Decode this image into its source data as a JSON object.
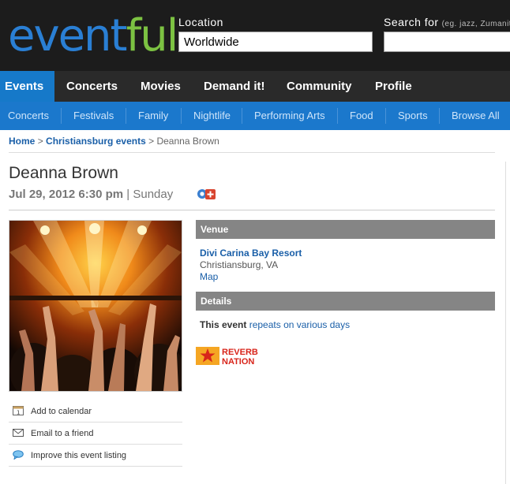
{
  "header": {
    "logo_part1": "event",
    "logo_part2": "ful",
    "location_label": "Location",
    "location_value": "Worldwide",
    "search_label": "Search for",
    "search_hint": "(eg. jazz, Zumanit"
  },
  "nav": {
    "items": [
      "Events",
      "Concerts",
      "Movies",
      "Demand it!",
      "Community",
      "Profile"
    ],
    "active": "Events"
  },
  "subnav": {
    "items": [
      "Concerts",
      "Festivals",
      "Family",
      "Nightlife",
      "Performing Arts",
      "Food",
      "Sports",
      "Browse All"
    ]
  },
  "breadcrumb": {
    "home": "Home",
    "city": "Christiansburg events",
    "current": "Deanna Brown",
    "separator": ">"
  },
  "event": {
    "title": "Deanna Brown",
    "date_time": "Jul 29, 2012 6:30 pm",
    "separator": "|",
    "weekday": "Sunday"
  },
  "actions": [
    "Add to calendar",
    "Email to a friend",
    "Improve this event listing"
  ],
  "venue": {
    "heading": "Venue",
    "name": "Divi Carina Bay Resort",
    "city": "Christiansburg, VA",
    "map_label": "Map"
  },
  "details": {
    "heading": "Details",
    "prefix": "This event",
    "link": "repeats on various days"
  },
  "badge": {
    "line1": "REVERB",
    "line2": "NATION"
  },
  "colors": {
    "header_bg": "#1c1c1c",
    "nav_bg": "#2a2a2a",
    "nav_active": "#1679c9",
    "subnav_bg": "#1b78cc",
    "link": "#1a5fa8",
    "section_head": "#858585",
    "logo_blue": "#2a7fd4",
    "logo_green": "#7cc242",
    "reverb_red": "#e23b1f",
    "reverb_orange": "#f5a623"
  }
}
